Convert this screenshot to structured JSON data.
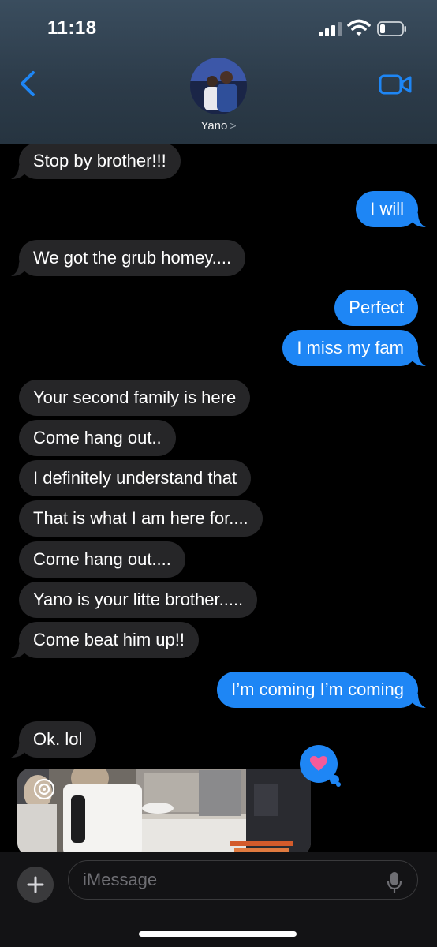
{
  "status_bar": {
    "time": "11:18"
  },
  "header": {
    "contact_name": "Yano",
    "contact_chevron": ">"
  },
  "messages": [
    {
      "side": "in",
      "text": "Stop by brother!!!"
    },
    {
      "side": "out",
      "text": "I will"
    },
    {
      "side": "in",
      "text": "We got the grub homey...."
    },
    {
      "side": "out",
      "text": "Perfect"
    },
    {
      "side": "out",
      "text": "I miss my fam"
    },
    {
      "side": "in",
      "text": "Your second family is here"
    },
    {
      "side": "in",
      "text": "Come hang out.."
    },
    {
      "side": "in",
      "text": "I definitely understand that"
    },
    {
      "side": "in",
      "text": "That is what I am here for...."
    },
    {
      "side": "in",
      "text": "Come hang out...."
    },
    {
      "side": "in",
      "text": "Yano is your litte brother....."
    },
    {
      "side": "in",
      "text": "Come beat him up!!"
    },
    {
      "side": "out",
      "text": "I’m coming I’m coming"
    },
    {
      "side": "in",
      "text": "Ok. lol"
    }
  ],
  "photo_message": {
    "tapback": "heart"
  },
  "compose": {
    "placeholder": "iMessage"
  },
  "colors": {
    "outgoing": "#1e86f5",
    "incoming": "#262628",
    "accent": "#1e86f5",
    "tapback_heart": "#f45b9a"
  }
}
